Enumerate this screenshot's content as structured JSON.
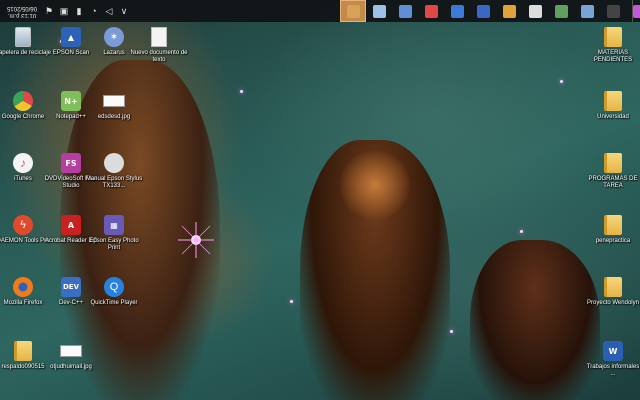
{
  "taskbar": {
    "clock_time": "01:13 p.m.",
    "clock_date": "06/05/2015",
    "tray_icons": [
      "network-icon",
      "message-icon",
      "battery-icon",
      "wifi-icon",
      "volume-icon",
      "chevron-up-icon"
    ],
    "task_icons": [
      {
        "name": "task-window",
        "color": "#d9a15a",
        "active": true
      },
      {
        "name": "task-notepad",
        "color": "#9cc0e8"
      },
      {
        "name": "task-settings",
        "color": "#5f8fd6"
      },
      {
        "name": "task-chrome",
        "color": "#e04848"
      },
      {
        "name": "task-explorer",
        "color": "#3a7bd5"
      },
      {
        "name": "task-people",
        "color": "#3a66c4"
      },
      {
        "name": "task-colors",
        "color": "#e2a23a"
      },
      {
        "name": "task-gear",
        "color": "#dcdcdc"
      },
      {
        "name": "task-clipboard",
        "color": "#5fa05f"
      },
      {
        "name": "task-photos",
        "color": "#7aa3d6"
      },
      {
        "name": "task-media",
        "color": "#444444"
      },
      {
        "name": "task-search",
        "color": "#c25bd6"
      },
      {
        "name": "task-view",
        "color": "#cfcfcf"
      }
    ]
  },
  "desktop": {
    "icons": [
      {
        "label": "Papelera de reciclaje",
        "icon": "recycle-bin-icon"
      },
      {
        "label": "EPSON Scan",
        "icon": "scanner-icon"
      },
      {
        "label": "Lazarus",
        "icon": "lazarus-icon"
      },
      {
        "label": "Nuevo documento de texto",
        "icon": "text-file-icon"
      },
      {
        "label": "Google Chrome",
        "icon": "chrome-icon"
      },
      {
        "label": "Notepad++",
        "icon": "notepad-plus-icon"
      },
      {
        "label": "edsdesd.jpg",
        "icon": "image-file-icon"
      },
      {
        "label": "iTunes",
        "icon": "itunes-icon"
      },
      {
        "label": "DVDVideoSoft Free Studio",
        "icon": "dvdvideosoft-icon"
      },
      {
        "label": "Manual Epson Stylus TX133...",
        "icon": "manual-icon"
      },
      {
        "label": "DAEMON Tools Pro",
        "icon": "daemon-tools-icon"
      },
      {
        "label": "Acrobat Reader DC",
        "icon": "acrobat-icon"
      },
      {
        "label": "Epson Easy Photo Print",
        "icon": "epson-photo-icon"
      },
      {
        "label": "Mozilla Firefox",
        "icon": "firefox-icon"
      },
      {
        "label": "Dev-C++",
        "icon": "devcpp-icon"
      },
      {
        "label": "QuickTime Player",
        "icon": "quicktime-icon"
      },
      {
        "label": "respaldo090515",
        "icon": "folder-icon"
      },
      {
        "label": "otjudhuimail.jpg",
        "icon": "image-file-icon"
      },
      {
        "label": "MATERIAS PENDIENTES",
        "icon": "folder-icon"
      },
      {
        "label": "Universidad",
        "icon": "folder-icon"
      },
      {
        "label": "PROGRAMAS DE TAREA",
        "icon": "folder-icon"
      },
      {
        "label": "penepractica",
        "icon": "folder-icon"
      },
      {
        "label": "Proyecto Wendolyn",
        "icon": "folder-icon"
      },
      {
        "label": "Trabajos informales ...",
        "icon": "word-doc-icon"
      }
    ]
  }
}
